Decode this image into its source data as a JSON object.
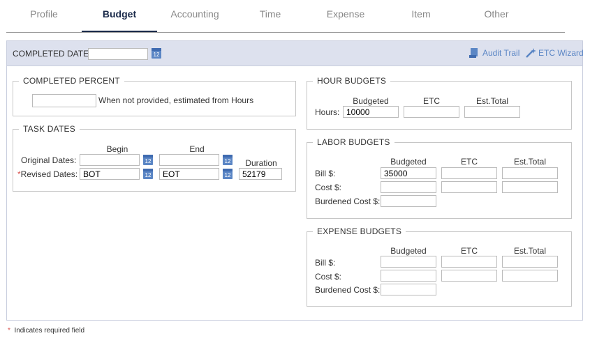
{
  "tabs": [
    {
      "label": "Profile"
    },
    {
      "label": "Budget"
    },
    {
      "label": "Accounting"
    },
    {
      "label": "Time"
    },
    {
      "label": "Expense"
    },
    {
      "label": "Item"
    },
    {
      "label": "Other"
    }
  ],
  "active_tab": "Budget",
  "header": {
    "completed_date_label": "COMPLETED DATE:",
    "completed_date_value": "",
    "audit_trail_label": "Audit Trail",
    "etc_wizard_label": "ETC Wizard"
  },
  "calendar_icon_text": "12",
  "completed_percent": {
    "legend": "COMPLETED PERCENT",
    "value": "",
    "note": "When not provided, estimated from Hours"
  },
  "task_dates": {
    "legend": "TASK DATES",
    "begin_header": "Begin",
    "end_header": "End",
    "duration_header": "Duration",
    "original_label": "Original Dates:",
    "revised_label": "Revised Dates:",
    "required_mark": "*",
    "original_begin": "",
    "original_end": "",
    "revised_begin": "BOT",
    "revised_end": "EOT",
    "duration": "52179"
  },
  "hour_budgets": {
    "legend": "HOUR BUDGETS",
    "budgeted_header": "Budgeted",
    "etc_header": "ETC",
    "est_total_header": "Est.Total",
    "hours_label": "Hours:",
    "hours_budgeted": "10000",
    "hours_etc": "",
    "hours_est_total": ""
  },
  "labor_budgets": {
    "legend": "LABOR BUDGETS",
    "budgeted_header": "Budgeted",
    "etc_header": "ETC",
    "est_total_header": "Est.Total",
    "bill_label": "Bill $:",
    "cost_label": "Cost $:",
    "burdened_label": "Burdened Cost $:",
    "bill_budgeted": "35000",
    "bill_etc": "",
    "bill_est_total": "",
    "cost_budgeted": "",
    "cost_etc": "",
    "cost_est_total": "",
    "burdened_budgeted": ""
  },
  "expense_budgets": {
    "legend": "EXPENSE BUDGETS",
    "budgeted_header": "Budgeted",
    "etc_header": "ETC",
    "est_total_header": "Est.Total",
    "bill_label": "Bill $:",
    "cost_label": "Cost $:",
    "burdened_label": "Burdened Cost $:",
    "bill_budgeted": "",
    "bill_etc": "",
    "bill_est_total": "",
    "cost_budgeted": "",
    "cost_etc": "",
    "cost_est_total": "",
    "burdened_budgeted": ""
  },
  "footer": {
    "required_mark": "*",
    "required_note": "Indicates required field"
  },
  "colors": {
    "accent": "#5b86c5",
    "active_tab": "#1a2a4a",
    "band": "#dde1ee",
    "required": "#d9534f"
  }
}
